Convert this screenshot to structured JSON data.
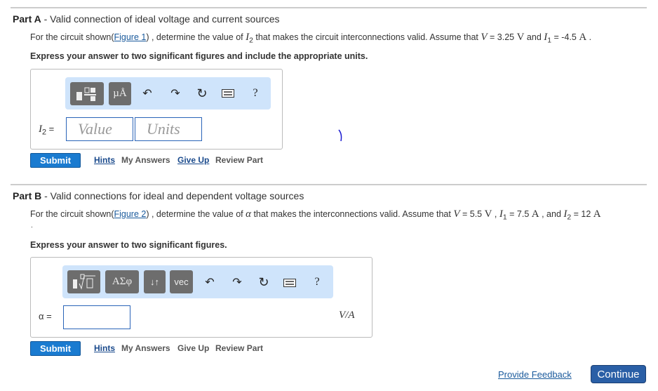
{
  "partA": {
    "label": "Part A",
    "title": " - Valid connection of ideal voltage and current sources",
    "text1": "For the circuit shown(",
    "figure": "Figure 1",
    "text2": ") , determine the value of ",
    "var": "I",
    "sub": "2",
    "text3": " that makes the circuit interconnections valid.  Assume that ",
    "V": "V",
    "eq1": " = 3.25 ",
    "unitV": "V",
    "and": " and ",
    "I1": "I",
    "I1sub": "1",
    "eq2": " = -4.5 ",
    "unitA": "A",
    "end": " .",
    "instruction": "Express your answer to two significant figures and include the appropriate units.",
    "toolbar": {
      "template": "template-icon",
      "units": "µÅ",
      "help": "?"
    },
    "answer_label": "I",
    "answer_sub": "2",
    "answer_eq": " =",
    "value_placeholder": "Value",
    "units_placeholder": "Units",
    "submit": "Submit",
    "hints": "Hints",
    "my_answers": "My Answers",
    "give_up": "Give Up",
    "review": "Review Part"
  },
  "partB": {
    "label": "Part B",
    "title": " - Valid connections for ideal and dependent voltage sources",
    "text1": "For the circuit shown(",
    "figure": "Figure 2",
    "text2": ") , determine the value of ",
    "var": "α",
    "text3": " that makes the interconnections valid. Assume that ",
    "V": "V",
    "eq1": " = 5.5 ",
    "unitV": "V",
    "sep": " ,  ",
    "I1": "I",
    "I1sub": "1",
    "eq2": " = 7.5 ",
    "unitA": "A",
    "and": " , and ",
    "I2": "I",
    "I2sub": "2",
    "eq3": " = 12 ",
    "unitA2": "A",
    "dot": ".",
    "instruction": "Express your answer to two significant figures.",
    "toolbar": {
      "greek": "ΑΣφ",
      "arrows": "↓↑",
      "vec": "vec",
      "help": "?"
    },
    "answer_label": "α =",
    "unit": "V/A",
    "submit": "Submit",
    "hints": "Hints",
    "my_answers": "My Answers",
    "give_up": "Give Up",
    "review": "Review Part"
  },
  "footer": {
    "feedback": "Provide Feedback",
    "continue": "Continue"
  },
  "colors": {
    "accent": "#1a7bd0",
    "toolbar": "#cfe4fb",
    "link": "#1a5a9c"
  }
}
